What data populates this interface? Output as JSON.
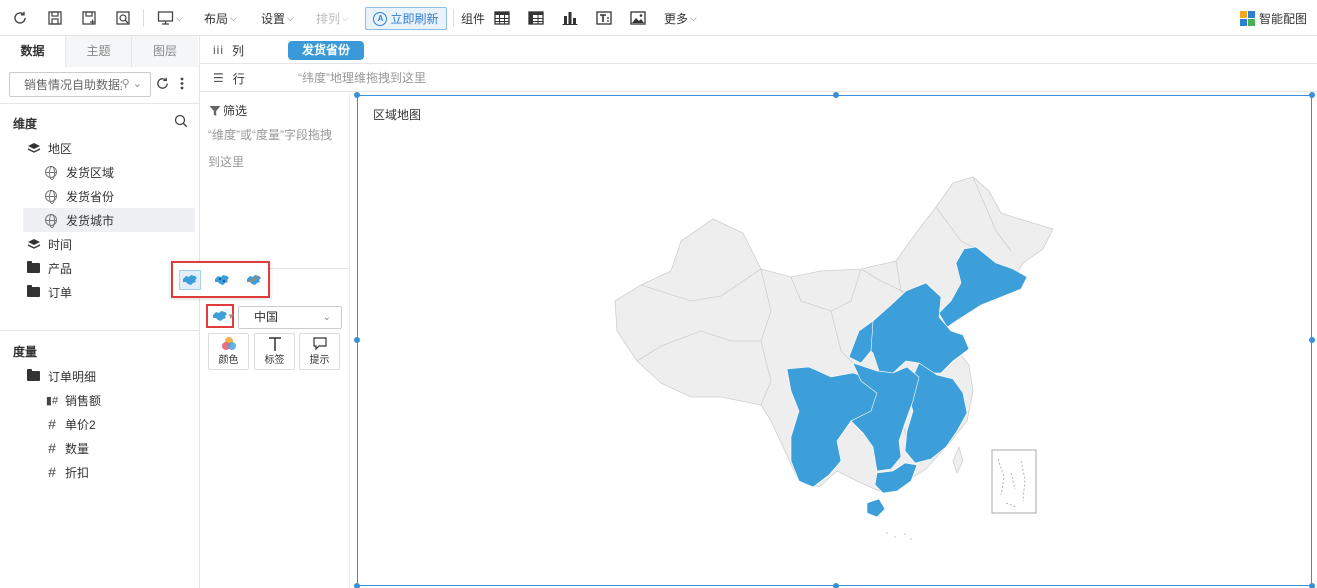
{
  "toolbar": {
    "layout_label": "布局",
    "settings_label": "设置",
    "arrange_label": "排列",
    "refresh_label": "立即刷新",
    "components_label": "组件",
    "more_label": "更多",
    "smart_label": "智能配图"
  },
  "left_panel": {
    "tabs": [
      {
        "label": "数据"
      },
      {
        "label": "主题"
      },
      {
        "label": "图层"
      }
    ],
    "dataset": "销售情况自助数据集",
    "dimensions_title": "维度",
    "dimensions": [
      {
        "label": "地区",
        "icon": "layers-icon"
      },
      {
        "label": "发货区域",
        "icon": "globe-icon"
      },
      {
        "label": "发货省份",
        "icon": "globe-icon"
      },
      {
        "label": "发货城市",
        "icon": "globe-icon"
      },
      {
        "label": "时间",
        "icon": "layers-icon"
      },
      {
        "label": "产品",
        "icon": "folder-icon"
      },
      {
        "label": "订单",
        "icon": "folder-icon"
      }
    ],
    "measures_title": "度量",
    "measures": [
      {
        "label": "订单明细",
        "icon": "folder-open-icon"
      },
      {
        "label": "销售额",
        "icon": "hash-icon"
      },
      {
        "label": "单价2",
        "icon": "hash-icon"
      },
      {
        "label": "数量",
        "icon": "hash-icon"
      },
      {
        "label": "折扣",
        "icon": "hash-icon"
      }
    ]
  },
  "shelves": {
    "columns_label": "列",
    "columns_pill": "发货省份",
    "rows_label": "行",
    "rows_hint": "“纬度”地理维拖拽到这里"
  },
  "config": {
    "filter_title": "筛选",
    "filter_hint": "“维度”或“度量”字段拖拽到这里",
    "region": "中国",
    "marks": [
      {
        "label": "颜色"
      },
      {
        "label": "标签"
      },
      {
        "label": "提示"
      }
    ]
  },
  "chart": {
    "title": "区域地图",
    "fill_color": "#3d9fd9",
    "base_color": "#eeeeee"
  }
}
